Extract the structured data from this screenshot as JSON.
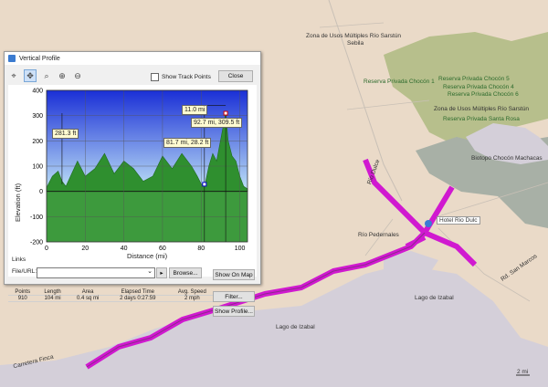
{
  "map": {
    "labels": {
      "reserva_sarstun": "Zona de Usos Múltiples Río Sarstún",
      "sebila": "Sebila",
      "chocon5": "Reserva Privada Chocón 5",
      "chocon1": "Reserva Privada Chocón 1",
      "chocon4": "Reserva Privada Chocón 4",
      "chocon6": "Reserva Privada Chocón 6",
      "zona_sarstun2": "Zona de Usos Múltiples Río Sarstún",
      "santa_rosa": "Reserva Privada Santa Rosa",
      "biotopo": "Biotopo Chocón Machacas",
      "hotel": "Hotel Rio Dulc",
      "rio_pedernales": "Río Pedernales",
      "lago": "Lago de Izabal",
      "lago2": "Lago de Izabal",
      "carretera": "Carretera Finca",
      "rio_dulce": "Río Dulce",
      "san_marcos": "Rd. San Marcos",
      "scale": "2 mi"
    }
  },
  "dialog": {
    "title": "Vertical Profile",
    "show_track_points": "Show Track Points",
    "close": "Close",
    "ylabel": "Elevation (ft)",
    "xlabel": "Distance    (mi)",
    "callouts": {
      "distance": "11.0 mi",
      "max_point": "92.7 mi, 309.5 ft",
      "cursor_point": "81.7 mi, 28.2 ft",
      "delta": "281.3 ft"
    },
    "stats": {
      "headers": [
        "Points",
        "Length",
        "Area",
        "Elapsed Time",
        "Avg. Speed"
      ],
      "values": [
        "910",
        "104 mi",
        "0.4 sq mi",
        "2 days 0:27:59",
        "2 mph"
      ]
    },
    "filter": "Filter...",
    "show_profile": "Show Profile...",
    "links": "Links",
    "file_url": "File/URL:",
    "browse": "Browse...",
    "show_on_map": "Show On Map"
  },
  "chart_data": {
    "type": "area",
    "xlabel": "Distance    (mi)",
    "ylabel": "Elevation (ft)",
    "xlim": [
      0,
      104
    ],
    "ylim": [
      -200,
      400
    ],
    "xticks": [
      0,
      20,
      40,
      60,
      80,
      100
    ],
    "yticks": [
      -200,
      -100,
      0,
      100,
      200,
      300,
      400
    ],
    "series": [
      {
        "x": [
          0,
          3,
          6,
          8,
          10,
          13,
          16,
          20,
          25,
          30,
          35,
          40,
          45,
          50,
          55,
          60,
          65,
          70,
          75,
          78,
          80,
          82,
          84,
          86,
          88,
          90,
          92.7,
          94,
          96,
          98,
          100,
          102,
          104
        ],
        "y": [
          15,
          60,
          80,
          40,
          20,
          70,
          120,
          60,
          90,
          150,
          70,
          120,
          90,
          40,
          60,
          140,
          90,
          150,
          100,
          60,
          30,
          28,
          100,
          150,
          120,
          200,
          309,
          200,
          140,
          120,
          60,
          20,
          10
        ]
      }
    ]
  }
}
